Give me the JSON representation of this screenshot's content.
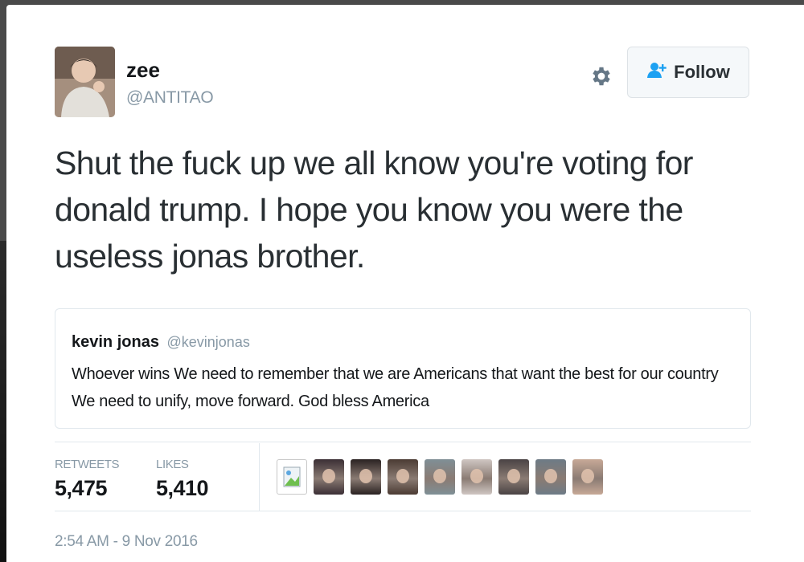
{
  "tweet": {
    "author": {
      "name": "zee",
      "handle": "@ANTITAO"
    },
    "follow_label": "Follow",
    "text": "Shut the fuck up we all know you're voting for donald trump. I hope you know you were the useless jonas brother.",
    "quoted": {
      "name": "kevin jonas",
      "handle": "@kevinjonas",
      "text": "Whoever wins We need to remember that we are Americans that want the best for our country We need to unify, move forward. God bless America"
    },
    "stats": {
      "retweets_label": "RETWEETS",
      "retweets": "5,475",
      "likes_label": "LIKES",
      "likes": "5,410"
    },
    "likers": [
      {
        "color": "#ffffff",
        "broken": true
      },
      {
        "color": "#3b2f35"
      },
      {
        "color": "#2a2222"
      },
      {
        "color": "#4b3b33"
      },
      {
        "color": "#7f8f96"
      },
      {
        "color": "#cfc6c2"
      },
      {
        "color": "#4a4344"
      },
      {
        "color": "#6d7b86"
      },
      {
        "color": "#c7a997"
      }
    ],
    "timestamp": "2:54 AM - 9 Nov 2016"
  },
  "icons": {
    "gear": "gear-icon",
    "follow": "add-user-icon",
    "broken_image": "broken-image-icon"
  },
  "colors": {
    "muted_text": "#8899a6",
    "link_blue": "#1da1f2",
    "border": "#e1e8ed"
  }
}
